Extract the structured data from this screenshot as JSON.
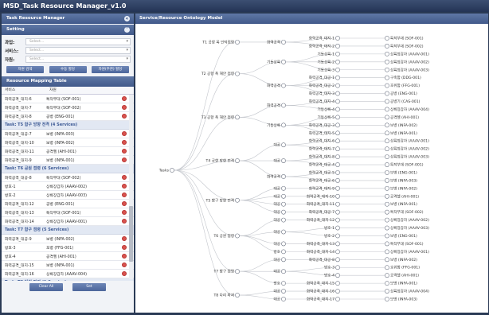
{
  "app": {
    "title": "MSD_Task Resource Manager_v1.0"
  },
  "left_panel": {
    "title": "Task Resource Manager",
    "setting": {
      "title": "Setting",
      "fields": [
        {
          "label": "과업:",
          "placeholder": "Select..."
        },
        {
          "label": "서비스:",
          "placeholder": "Select..."
        },
        {
          "label": "자원:",
          "placeholder": "Select..."
        }
      ],
      "buttons": [
        "자원 검색",
        "수동 할당",
        "자원(주관) 할당"
      ]
    },
    "mapping": {
      "title": "Resource Mapping Table",
      "columns": [
        "서비스",
        "자원"
      ],
      "rows": [
        {
          "type": "row",
          "service": "화력공격_대지-6",
          "resource": "특작부대 (SOF-001)"
        },
        {
          "type": "row",
          "service": "화력공격_대지-7",
          "resource": "특작부대 (SOF-002)"
        },
        {
          "type": "row",
          "service": "화력공격_대지-8",
          "resource": "공병 (ENG-001)"
        },
        {
          "type": "task",
          "label": "Task: T5 함구 방향 전격 (4 Services)"
        },
        {
          "type": "row",
          "service": "화력공격_대공-7",
          "resource": "보병 (INFA-003)"
        },
        {
          "type": "row",
          "service": "화력공격_대지-10",
          "resource": "보병 (INFA-002)"
        },
        {
          "type": "row",
          "service": "화력공격_대지-11",
          "resource": "공격헬 (AHI-001)"
        },
        {
          "type": "row",
          "service": "화력공격_대지-9",
          "resource": "보병 (INFA-001)"
        },
        {
          "type": "task",
          "label": "Task: T6 공원 점령 (6 Services)"
        },
        {
          "type": "row",
          "service": "화력공격_대공-8",
          "resource": "특작부대 (SOF-002)"
        },
        {
          "type": "row",
          "service": "방호-1",
          "resource": "상륙장갑차 (AAAV-002)"
        },
        {
          "type": "row",
          "service": "방호-2",
          "resource": "상륙장갑차 (AAAV-003)"
        },
        {
          "type": "row",
          "service": "화력공격_대지-12",
          "resource": "공병 (ENG-001)"
        },
        {
          "type": "row",
          "service": "화력공격_대지-13",
          "resource": "특작부대 (SOF-001)"
        },
        {
          "type": "row",
          "service": "화력공격_대지-14",
          "resource": "상륙장갑차 (AAAV-001)"
        },
        {
          "type": "task",
          "label": "Task: T7 함구 점령 (5 Services)"
        },
        {
          "type": "row",
          "service": "화력공격_대공-9",
          "resource": "보병 (INFA-002)"
        },
        {
          "type": "row",
          "service": "방호-3",
          "resource": "포병 (FFG-001)"
        },
        {
          "type": "row",
          "service": "방호-4",
          "resource": "공격헬 (AHI-001)"
        },
        {
          "type": "row",
          "service": "화력공격_대지-15",
          "resource": "보병 (INFA-001)"
        },
        {
          "type": "row",
          "service": "화력공격_대지-16",
          "resource": "상륙장갑차 (AAAV-004)"
        },
        {
          "type": "task",
          "label": "Task: T8 다리 파괴 (1 Service)"
        },
        {
          "type": "row",
          "service": "화력공격_대지-17",
          "resource": "보병 (INFA-003)"
        }
      ],
      "buttons": [
        "Clear All",
        "Set"
      ]
    }
  },
  "right_panel": {
    "title": "Service/Resource Ontology Model",
    "root": "Tasks",
    "tasks": [
      {
        "label": "T1 공항 폭 인덕점령"
      },
      {
        "label": "T2 공항 폭 해안 점령"
      },
      {
        "label": "T3 공항 폭 해안 점령"
      },
      {
        "label": "T4 공항 방향 전격"
      },
      {
        "label": "T5 함구 방향 전격"
      },
      {
        "label": "T6 공원 점령"
      },
      {
        "label": "T7 함구 점령"
      },
      {
        "label": "T8 다리 파괴"
      }
    ],
    "categories": [
      "화력공격",
      "기동상륙",
      "화력공격",
      "화력공격",
      "기동상륙",
      "대공",
      "대공",
      "화력공격",
      "대공",
      "대공",
      "대공",
      "대공",
      "대공",
      "대공",
      "대공",
      "방호",
      "대공",
      "대공",
      "방호",
      "대공",
      "대공"
    ],
    "services": [
      "화력공격_대지-1",
      "화력공격_대지-2",
      "기동상륙-1",
      "기동상륙-2",
      "기동상륙-3",
      "화력공격_대공-1",
      "화력공격_대공-2",
      "화력공격_대지-3",
      "화력공격_대지-4",
      "기동상륙-4",
      "기동상륙-5",
      "화력공격_대공-3",
      "화력공격_대지-5",
      "화력공격_대지-6",
      "화력공격_대지-7",
      "화력공격_대지-8",
      "화력공격_대공-4",
      "화력공격_대공-5",
      "화력공격_대공-6",
      "화력공격_대지-9",
      "화력공격_대지-10",
      "화력공격_대지-11",
      "화력공격_대공-7",
      "화력공격_대지-12",
      "방호-1",
      "방호-2",
      "화력공격_대지-13",
      "화력공격_대지-14",
      "화력공격_대공-8",
      "방호-3",
      "방호-4",
      "화력공격_대지-15",
      "화력공격_대지-16",
      "화력공격_대지-17"
    ],
    "resources": [
      "특작부대 (SOF-001)",
      "특작부대 (SOF-002)",
      "상륙장갑차 (AAAV-001)",
      "상륙장갑차 (AAAV-002)",
      "상륙장갑차 (AAAV-003)",
      "구축함 (DDG-001)",
      "호위함 (FFG-001)",
      "공병 (ENG-001)",
      "공병기 (CAS-001)",
      "상륙장갑차 (AAAV-004)",
      "공격헬 (AHI-001)",
      "보병 (INFA-002)",
      "보병 (INFA-001)",
      "상륙장갑차 (AAAV-001)",
      "상륙장갑차 (AAAV-002)",
      "상륙장갑차 (AAAV-003)",
      "특작부대 (SOF-001)",
      "보병 (ENG-001)",
      "보병 (INFA-003)",
      "보병 (INFA-002)",
      "공격헬 (AHI-001)",
      "보병 (INFA-001)",
      "특작부대 (SOF-002)",
      "상륙장갑차 (AAAV-002)",
      "상륙장갑차 (AAAV-003)",
      "보병 (ENG-001)",
      "특작부대 (SOF-001)",
      "상륙장갑차 (AAAV-001)",
      "보병 (INFA-002)",
      "호위함 (FFG-001)",
      "공격헬 (AHI-001)",
      "보병 (INFA-001)",
      "상륙장갑차 (AAAV-004)",
      "보병 (INFA-003)"
    ]
  },
  "colors": {
    "titlebar": "#2e3f60",
    "panel_header": "#4f68 9a",
    "delete": "#d9534f",
    "task_text": "#3d5a95"
  }
}
